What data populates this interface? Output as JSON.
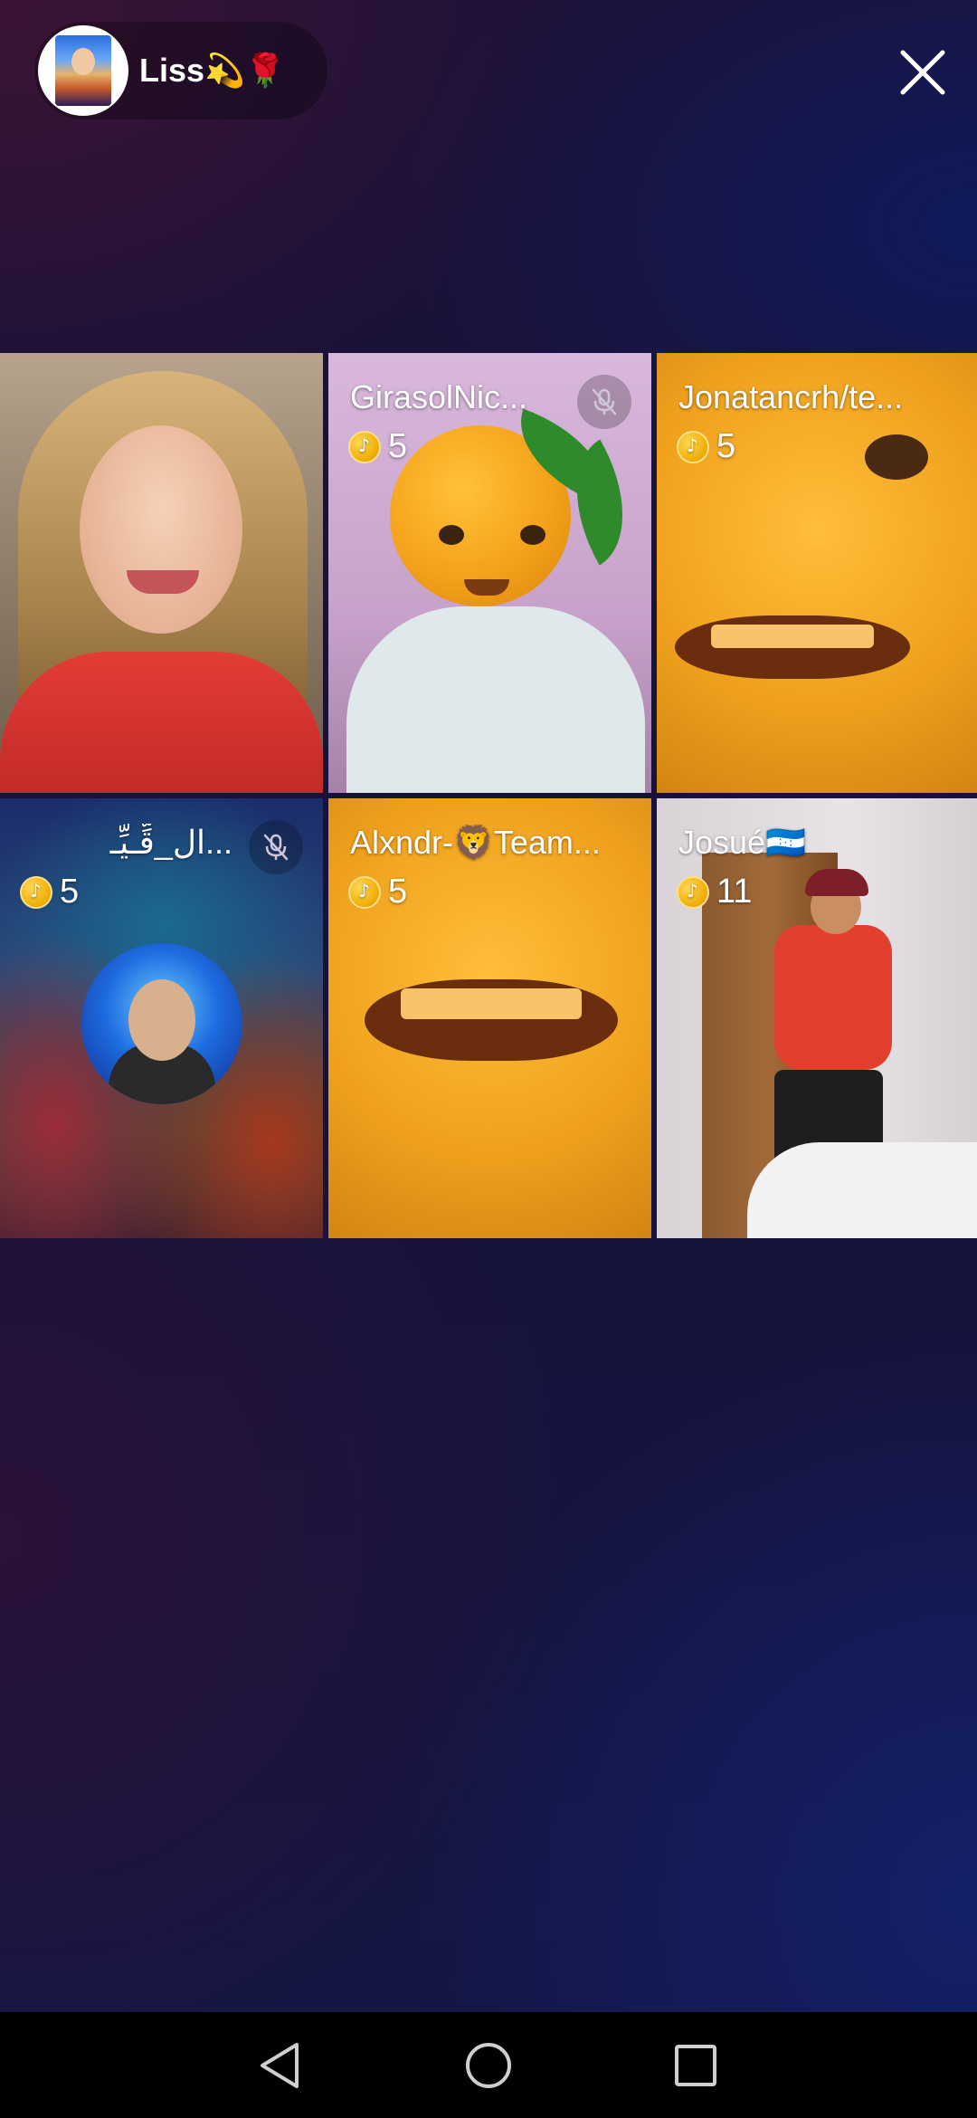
{
  "header": {
    "host_name": "Liss💫🌹"
  },
  "icons": {
    "close": "close-icon",
    "mute": "mic-off-icon",
    "coin": "coin-icon"
  },
  "guests": [
    {
      "name": "",
      "coins": "",
      "muted": false
    },
    {
      "name": "GirasolNic...",
      "coins": "5",
      "muted": true
    },
    {
      "name": "Jonatancrh/te...",
      "coins": "5",
      "muted": false
    },
    {
      "name": "ال_قِّـيِّـ...",
      "coins": "5",
      "muted": true
    },
    {
      "name": "Alxndr-🦁Team...",
      "coins": "5",
      "muted": false
    },
    {
      "name": "Josué🇭🇳",
      "coins": "11",
      "muted": false
    }
  ],
  "navbar": {
    "back": "back-triangle-icon",
    "home": "home-circle-icon",
    "recents": "recents-square-icon"
  }
}
